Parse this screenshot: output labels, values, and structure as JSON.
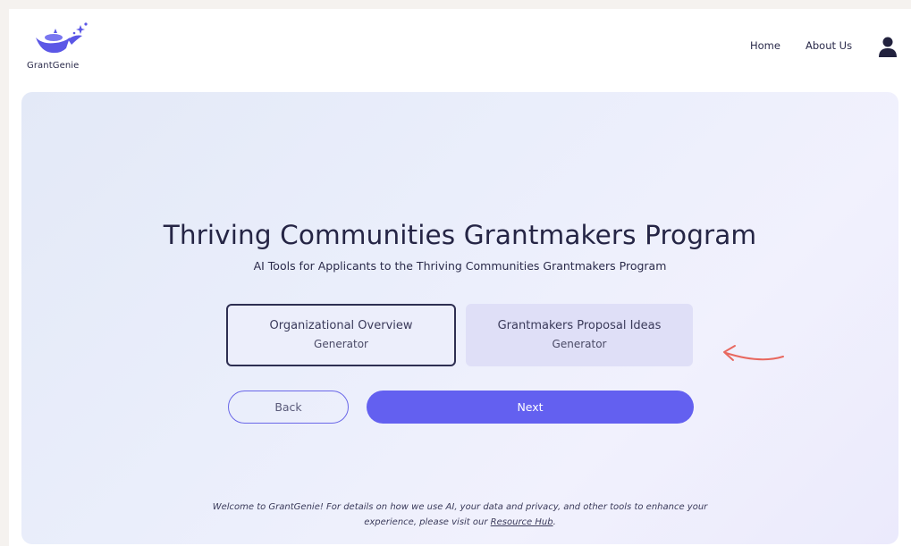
{
  "header": {
    "logo_text": "GrantGenie",
    "nav": {
      "home": "Home",
      "about": "About Us"
    }
  },
  "main": {
    "title": "Thriving Communities Grantmakers Program",
    "subtitle": "AI Tools for Applicants to the Thriving Communities Grantmakers Program",
    "options": [
      {
        "line1": "Organizational Overview",
        "line2": "Generator",
        "selected": true
      },
      {
        "line1": "Grantmakers Proposal Ideas",
        "line2": "Generator",
        "selected": false
      }
    ],
    "buttons": {
      "back": "Back",
      "next": "Next"
    }
  },
  "footer": {
    "line1": "Welcome to GrantGenie! For details on how we use AI, your data and privacy, and other tools to enhance your",
    "line2_prefix": "experience, please visit our",
    "link": "Resource Hub",
    "line2_suffix": "."
  },
  "colors": {
    "accent": "#6360f0",
    "selected_border": "#2e2f52",
    "annotation_arrow": "#e8685f"
  }
}
